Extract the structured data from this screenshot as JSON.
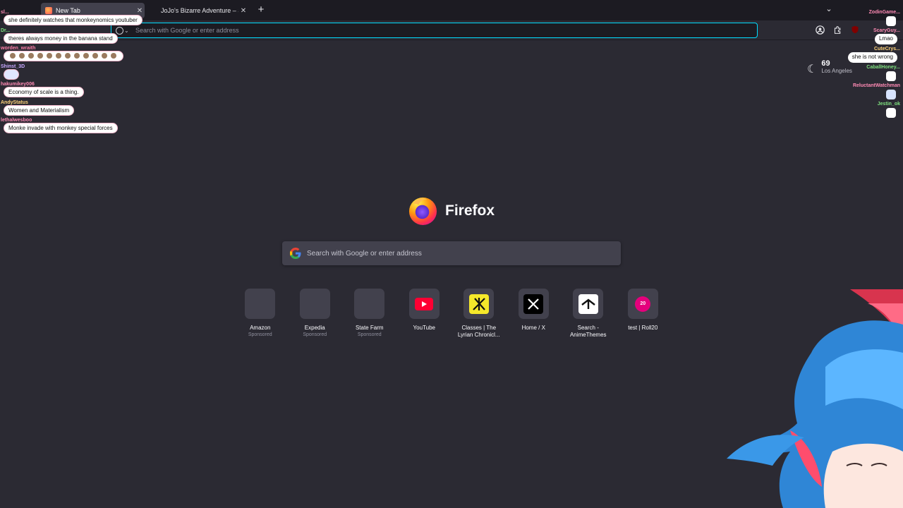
{
  "browser": {
    "tabs": [
      {
        "title": "New Tab",
        "active": true
      },
      {
        "title": "JoJo's Bizarre Adventure – Steam",
        "active": false
      }
    ],
    "urlbar_placeholder": "Search with Google or enter address"
  },
  "weather": {
    "temp": "69",
    "city": "Los Angeles"
  },
  "brand": {
    "name": "Firefox"
  },
  "search": {
    "placeholder": "Search with Google or enter address"
  },
  "top_sites": [
    {
      "label": "Amazon",
      "sponsored": "Sponsored",
      "icon": "blank"
    },
    {
      "label": "Expedia",
      "sponsored": "Sponsored",
      "icon": "blank"
    },
    {
      "label": "State Farm",
      "sponsored": "Sponsored",
      "icon": "blank"
    },
    {
      "label": "YouTube",
      "sponsored": "",
      "icon": "youtube-icon"
    },
    {
      "label": "Classes | The Lyrian Chronicl...",
      "sponsored": "",
      "icon": "lyrian-icon"
    },
    {
      "label": "Home / X",
      "sponsored": "",
      "icon": "x-icon"
    },
    {
      "label": "Search - AnimeThemes",
      "sponsored": "",
      "icon": "animethemes-icon"
    },
    {
      "label": "test | Roll20",
      "sponsored": "",
      "icon": "roll20-icon",
      "icon_text": "20"
    }
  ],
  "chat_left": [
    {
      "user": "sl...",
      "text": "she definitely watches that monkeynomics youtuber",
      "color": "#ff8ab4"
    },
    {
      "user": "Dr...",
      "text": "theres always money in the banana stand",
      "color": "#7ee07e"
    },
    {
      "user": "worden_wraith",
      "text": "",
      "color": "#ff7ea8"
    },
    {
      "user": "Shinst_3D",
      "text": "",
      "color": "#c8a8ff"
    },
    {
      "user": "hakumikey006",
      "text": "Economy of scale is a thing.",
      "color": "#ff8ab4"
    },
    {
      "user": "AndyStatus",
      "text": "Women and Materialism",
      "color": "#ffd37a"
    },
    {
      "user": "lethalwesboo",
      "text": "Monke invade with monkey special forces",
      "color": "#ff8ab4"
    }
  ],
  "chat_right": [
    {
      "user": "ZodinGame...",
      "text": "",
      "color": "#ff8ab4"
    },
    {
      "user": "ScaryGuy...",
      "text": "Lmao",
      "color": "#ff8ab4"
    },
    {
      "user": "CuteCrys...",
      "text": "she is not wrong",
      "color": "#ffd37a"
    },
    {
      "user": "CaballHoney...",
      "text": "",
      "color": "#7ee07e"
    },
    {
      "user": "ReluctantWatchman",
      "text": "",
      "color": "#ff8ab4"
    },
    {
      "user": "Jestin_ok",
      "text": "",
      "color": "#7ee07e"
    }
  ],
  "colors": {
    "accent": "#00ddff",
    "bg": "#2b2a33",
    "tile": "#42414d"
  }
}
